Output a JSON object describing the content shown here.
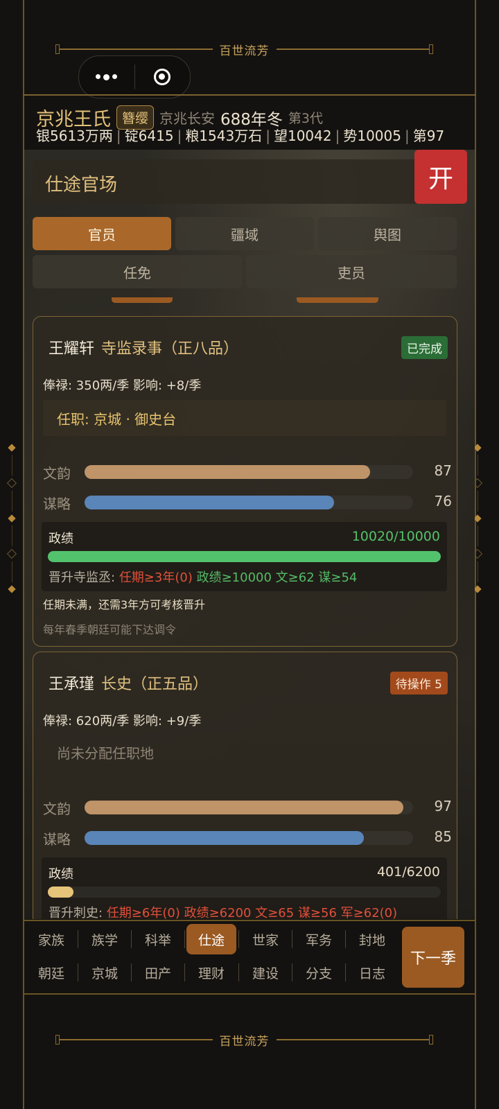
{
  "banner": {
    "title": "百世流芳"
  },
  "capsule": {
    "more_icon": "more-dots-icon",
    "close_icon": "target-icon"
  },
  "family": {
    "name": "京兆王氏",
    "badge": "簪缨",
    "location": "京兆长安",
    "year": "688年冬",
    "generation": "第3代"
  },
  "resources": [
    "银5613万两",
    "锭6415",
    "粮1543万石",
    "望10042",
    "势10005",
    "第97"
  ],
  "section": {
    "title": "仕途官场",
    "open_label": "开"
  },
  "tabs_row1": [
    {
      "label": "官员",
      "active": true
    },
    {
      "label": "疆域",
      "active": false
    },
    {
      "label": "舆图",
      "active": false
    }
  ],
  "tabs_row2": [
    {
      "label": "任免"
    },
    {
      "label": "吏员"
    }
  ],
  "officials": [
    {
      "name": "王耀轩",
      "rank": "寺监录事（正八品）",
      "status": "已完成",
      "salary_line": "俸禄: 350两/季   影响: +8/季",
      "post": "任职: 京城 · 御史台",
      "stats": [
        {
          "label": "文韵",
          "value": "87",
          "pct": 87
        },
        {
          "label": "谋略",
          "value": "76",
          "pct": 76
        }
      ],
      "performance": {
        "label": "政绩",
        "value": "10020/10000",
        "fraction": 1.0,
        "req_label": "晋升寺监丞:",
        "req_tenure": "任期≥3年(0)",
        "req_perf": "政绩≥10000",
        "req_wen": "文≥62",
        "req_mou": "谋≥54"
      },
      "note1": "任期未满，还需3年方可考核晋升",
      "note2": "每年春季朝廷可能下达调令"
    },
    {
      "name": "王承瑾",
      "rank": "长史（正五品）",
      "status": "待操作 5",
      "salary_line": "俸禄: 620两/季   影响: +9/季",
      "post": "尚未分配任职地",
      "stats": [
        {
          "label": "文韵",
          "value": "97",
          "pct": 97
        },
        {
          "label": "谋略",
          "value": "85",
          "pct": 85
        }
      ],
      "performance": {
        "label": "政绩",
        "value": "401/6200",
        "fraction": 0.065,
        "req_label": "晋升刺史:",
        "req_tenure": "任期≥6年(0)",
        "req_perf": "政绩≥6200",
        "req_wen": "文≥65",
        "req_mou": "谋≥56",
        "req_jun": "军≥62(0)"
      }
    }
  ],
  "bottom_nav": {
    "row1": [
      "家族",
      "族学",
      "科举",
      "仕途",
      "世家",
      "军务",
      "封地"
    ],
    "row2": [
      "朝廷",
      "京城",
      "田产",
      "理财",
      "建设",
      "分支",
      "日志"
    ],
    "active": "仕途",
    "next_label": "下一季"
  },
  "colors": {
    "accent": "#9b5a22",
    "gold": "#e0c07e",
    "wen_bar": "#bf9469",
    "mou_bar": "#5a85b8",
    "perf_done": "#53c26c",
    "perf_low": "#e6c47a",
    "open_red": "#c53030"
  }
}
